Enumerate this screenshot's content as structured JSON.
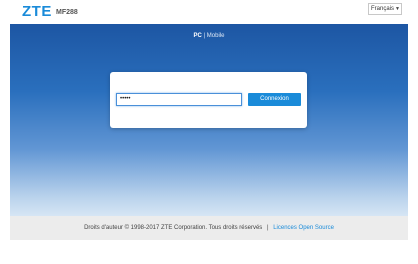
{
  "header": {
    "logo_text": "ZTE",
    "model": "MF288",
    "language": {
      "selected": "Français",
      "chevron_icon": "chevron-down-icon"
    }
  },
  "view_switch": {
    "pc_label": "PC",
    "separator": "|",
    "mobile_label": "Mobile"
  },
  "login": {
    "password_value": "•••••",
    "submit_label": "Connexion"
  },
  "footer": {
    "copyright": "Droits d'auteur © 1998-2017 ZTE Corporation. Tous droits réservés",
    "separator": "|",
    "license_link": "Licences Open Source"
  },
  "colors": {
    "accent": "#1a8bd9",
    "banner_top": "#1d56a3",
    "banner_bottom": "#d6e5f4",
    "footer_bg": "#ececec"
  }
}
